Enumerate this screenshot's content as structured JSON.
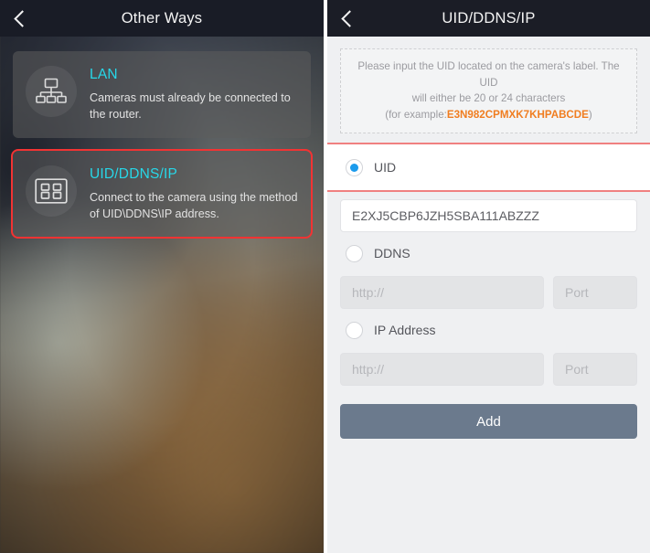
{
  "left_panel": {
    "header": {
      "title": "Other Ways",
      "back_icon": "chevron-left-icon"
    },
    "cards": [
      {
        "icon": "network-topology-icon",
        "title": "LAN",
        "description": "Cameras must already be connected to the router.",
        "highlighted": false
      },
      {
        "icon": "device-grid-icon",
        "title": "UID/DDNS/IP",
        "description": "Connect to the camera using the method of UID\\DDNS\\IP address.",
        "highlighted": true
      }
    ],
    "highlight_color": "#f23333",
    "title_color": "#27d7e8"
  },
  "right_panel": {
    "header": {
      "title": "UID/DDNS/IP",
      "back_icon": "chevron-left-icon"
    },
    "info": {
      "line1": "Please input the UID located on the camera's label. The UID",
      "line2": "will either be 20 or 24 characters",
      "line3_prefix": "(for example:",
      "example_code": "E3N982CPMXK7KHPABCDE",
      "line3_suffix": ")",
      "example_color": "#f07d20"
    },
    "options": [
      {
        "id": "uid",
        "label": "UID",
        "selected": true,
        "value": "E2XJ5CBP6JZH5SBA111ABZZZ"
      },
      {
        "id": "ddns",
        "label": "DDNS",
        "selected": false,
        "host_placeholder": "http://",
        "port_placeholder": "Port"
      },
      {
        "id": "ip",
        "label": "IP Address",
        "selected": false,
        "host_placeholder": "http://",
        "port_placeholder": "Port"
      }
    ],
    "submit_label": "Add",
    "submit_color": "#6b7a8d",
    "radio_on_color": "#1b9bec",
    "highlight_color": "#f08080"
  }
}
